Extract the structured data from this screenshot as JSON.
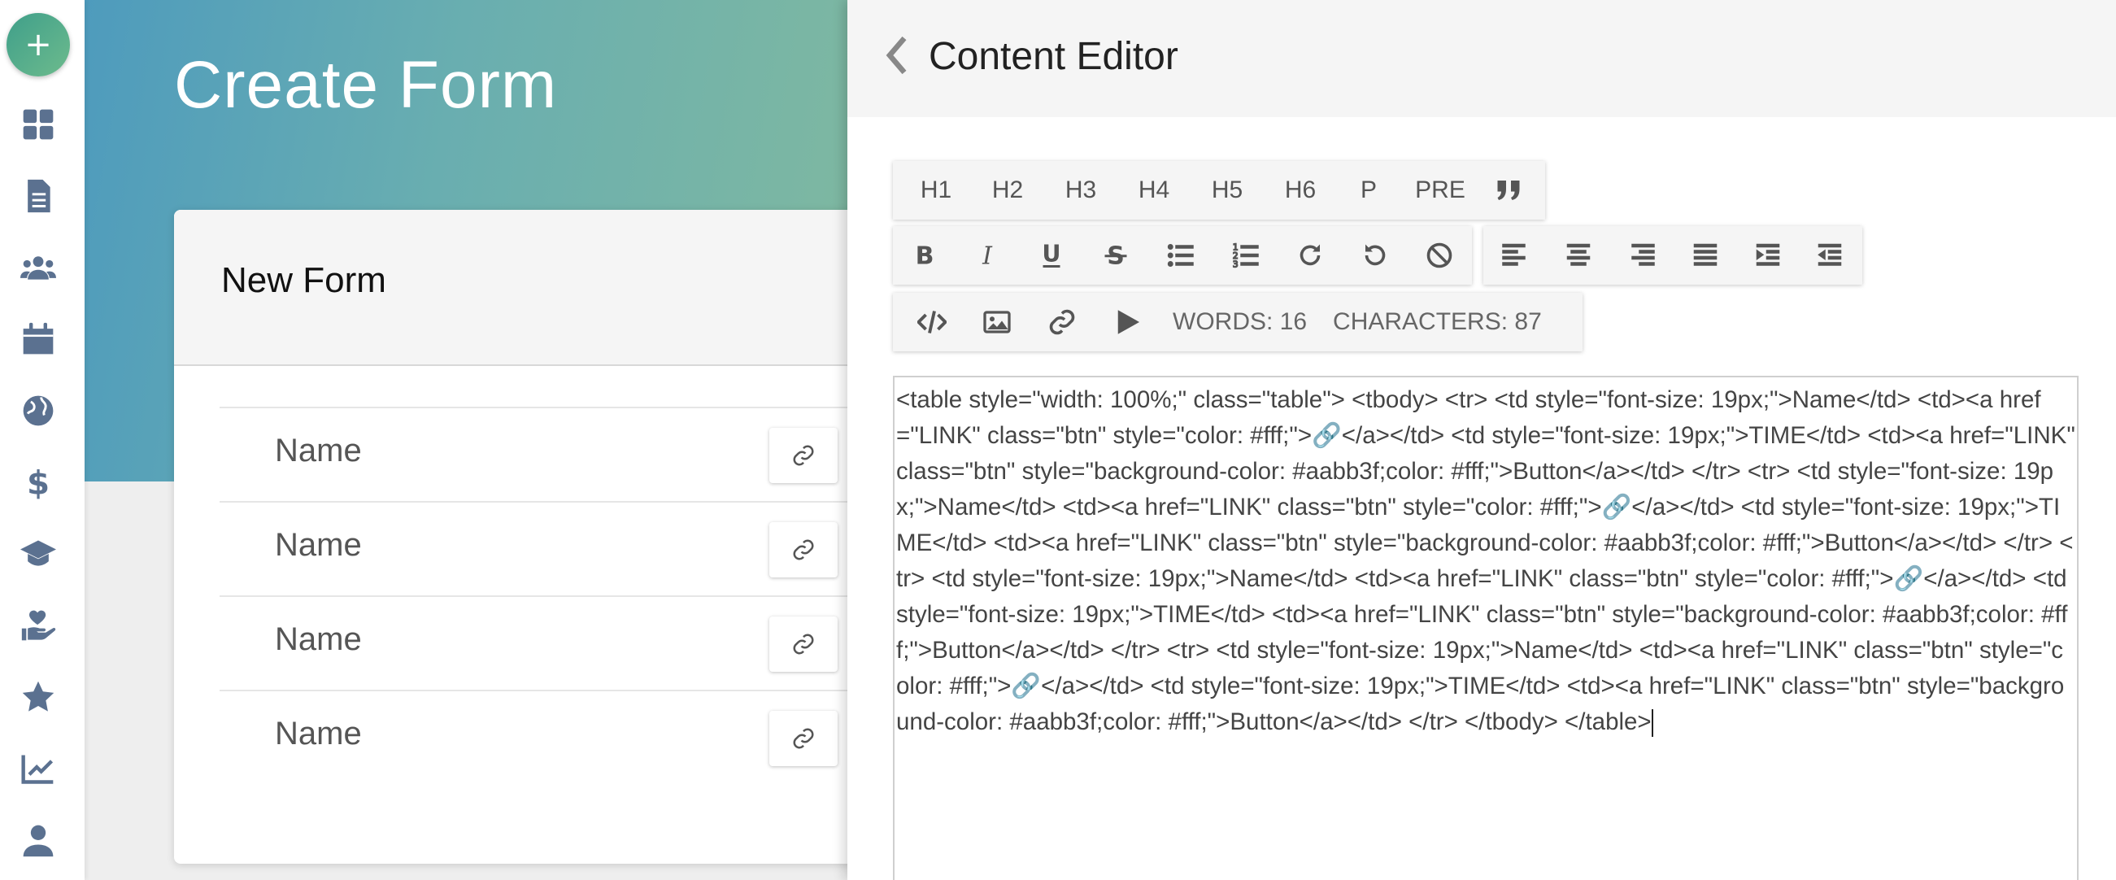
{
  "app": {
    "page_title": "Create Form",
    "fab_label": "+"
  },
  "rail": {
    "items": [
      {
        "icon": "dashboard-icon"
      },
      {
        "icon": "document-icon"
      },
      {
        "icon": "users-icon"
      },
      {
        "icon": "calendar-icon"
      },
      {
        "icon": "globe-icon"
      },
      {
        "icon": "dollar-icon"
      },
      {
        "icon": "graduation-cap-icon"
      },
      {
        "icon": "hand-heart-icon"
      },
      {
        "icon": "star-icon"
      },
      {
        "icon": "chart-line-icon"
      },
      {
        "icon": "user-icon"
      }
    ]
  },
  "card": {
    "title": "New Form",
    "rows": [
      {
        "label": "Name"
      },
      {
        "label": "Name"
      },
      {
        "label": "Name"
      },
      {
        "label": "Name"
      }
    ]
  },
  "editor": {
    "title": "Content Editor",
    "headings": [
      "H1",
      "H2",
      "H3",
      "H4",
      "H5",
      "H6",
      "P",
      "PRE"
    ],
    "word_count": "WORDS: 16",
    "char_count": "CHARACTERS: 87",
    "content": "<table style=\"width: 100%;\" class=\"table\"> <tbody> <tr> <td style=\"font-size: 19px;\">Name</td> <td><a href=\"LINK\" class=\"btn\" style=\"color: #fff;\">🔗</a></td> <td style=\"font-size: 19px;\">TIME</td> <td><a href=\"LINK\" class=\"btn\" style=\"background-color: #aabb3f;color: #fff;\">Button</a></td> </tr> <tr> <td style=\"font-size: 19px;\">Name</td> <td><a href=\"LINK\" class=\"btn\" style=\"color: #fff;\">🔗</a></td> <td style=\"font-size: 19px;\">TIME</td> <td><a href=\"LINK\" class=\"btn\" style=\"background-color: #aabb3f;color: #fff;\">Button</a></td> </tr> <tr> <td style=\"font-size: 19px;\">Name</td> <td><a href=\"LINK\" class=\"btn\" style=\"color: #fff;\">🔗</a></td> <td style=\"font-size: 19px;\">TIME</td> <td><a href=\"LINK\" class=\"btn\" style=\"background-color: #aabb3f;color: #fff;\">Button</a></td> </tr> <tr> <td style=\"font-size: 19px;\">Name</td> <td><a href=\"LINK\" class=\"btn\" style=\"color: #fff;\">🔗</a></td> <td style=\"font-size: 19px;\">TIME</td> <td><a href=\"LINK\" class=\"btn\" style=\"background-color: #aabb3f;color: #fff;\">Button</a></td> </tr> </tbody> </table>"
  },
  "colors": {
    "accent": "#3f9f8a",
    "hero_start": "#4e9bbd",
    "hero_end": "#80b9a0",
    "rail_icon": "#5b7190"
  }
}
